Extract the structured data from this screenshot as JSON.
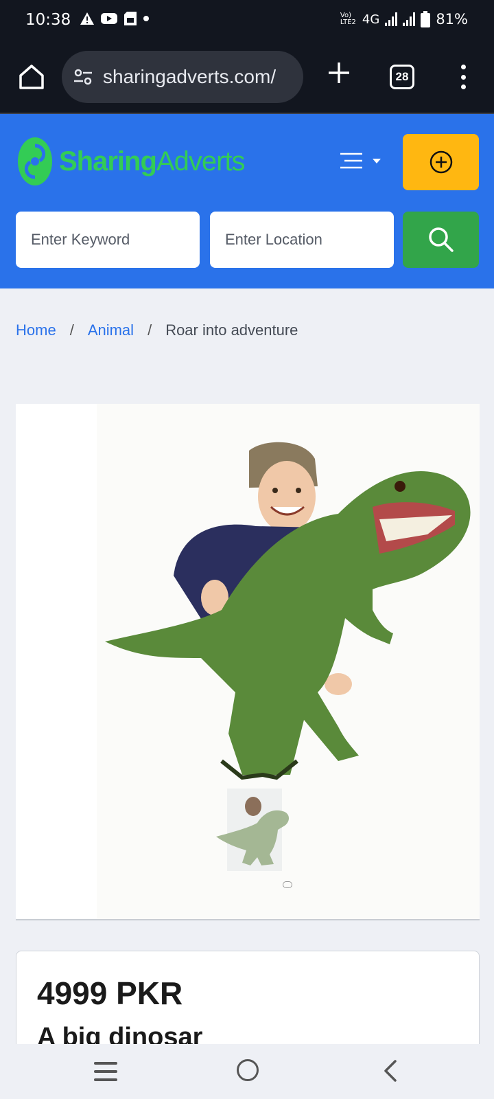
{
  "status_bar": {
    "time": "10:38",
    "network": "4G",
    "volte": "Vo) LTE2",
    "battery": "81%",
    "icons": [
      "alert-icon",
      "youtube-icon",
      "sim-icon",
      "dot-icon"
    ]
  },
  "browser": {
    "url": "sharingadverts.com/",
    "tab_count": "28"
  },
  "site": {
    "logo_part1": "Sharing",
    "logo_part2": "Adverts",
    "brand_colors": {
      "header": "#2a72ea",
      "logo": "#33cc55",
      "add": "#ffb711",
      "search": "#32a54a"
    }
  },
  "search": {
    "keyword_placeholder": "Enter Keyword",
    "location_placeholder": "Enter Location"
  },
  "breadcrumb": {
    "home": "Home",
    "category": "Animal",
    "current": "Roar into adventure",
    "separator": "/"
  },
  "listing": {
    "image_alt": "toy dinosaur with child",
    "price": "4999 PKR",
    "title": "A big dinosar"
  }
}
